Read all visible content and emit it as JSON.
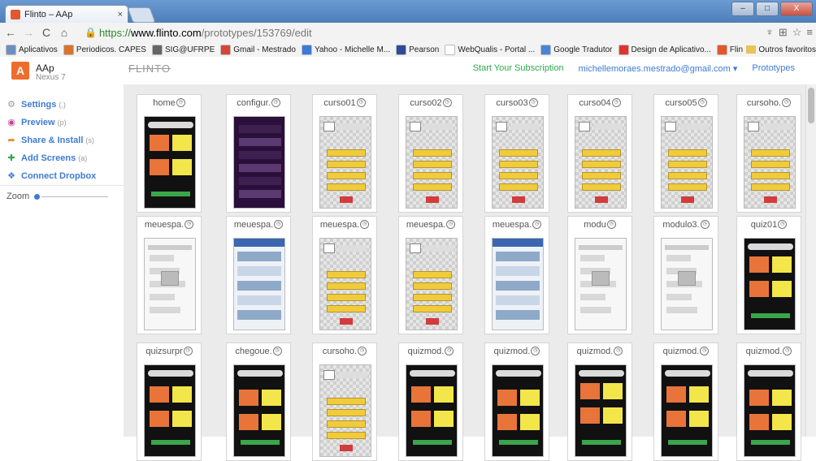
{
  "browser": {
    "tab_title": "Flinto – AAp",
    "tab_close": "×",
    "url_https": "https://",
    "url_host": "www.flinto.com",
    "url_path": "/prototypes/153769/edit",
    "win_min": "–",
    "win_max": "□",
    "win_close": "X"
  },
  "bookmarks": [
    {
      "label": "Aplicativos",
      "color": "#6d8fbf"
    },
    {
      "label": "Periodicos. CAPES",
      "color": "#d9732e"
    },
    {
      "label": "SIG@UFRPE",
      "color": "#666666"
    },
    {
      "label": "Gmail - Mestrado",
      "color": "#d64537"
    },
    {
      "label": "Yahoo - Michelle M...",
      "color": "#3b7bd6"
    },
    {
      "label": "Pearson",
      "color": "#2e4b9a"
    },
    {
      "label": "WebQualis - Portal ...",
      "color": "#ffffff"
    },
    {
      "label": "Google Tradutor",
      "color": "#4a84d8"
    },
    {
      "label": "Design de Aplicativo...",
      "color": "#e0342d"
    },
    {
      "label": "Flinto – Prototypes",
      "color": "#e2572b"
    }
  ],
  "bookmarks_other": "Outros favoritos",
  "app": {
    "icon_letter": "A",
    "name": "AAp",
    "device": "Nexus 7",
    "logo": "FLINTO",
    "subscription": "Start Your Subscription",
    "email": "michellemoraes.mestrado@gmail.com ▾",
    "prototypes": "Prototypes"
  },
  "sidebar": {
    "items": [
      {
        "label": "Settings",
        "key": "(,)",
        "icon": "gear-icon",
        "color": "#999999"
      },
      {
        "label": "Preview",
        "key": "(p)",
        "icon": "eye-icon",
        "color": "#c2459a"
      },
      {
        "label": "Share & Install",
        "key": "(s)",
        "icon": "share-icon",
        "color": "#e38a2c"
      },
      {
        "label": "Add Screens",
        "key": "(a)",
        "icon": "plus-icon",
        "color": "#2fa84f"
      },
      {
        "label": "Connect Dropbox",
        "key": "",
        "icon": "dropbox-icon",
        "color": "#3e7bd4"
      }
    ],
    "zoom_label": "Zoom"
  },
  "screens": [
    {
      "label": "home",
      "style": "black"
    },
    {
      "label": "configur.",
      "style": "purple"
    },
    {
      "label": "curso01",
      "style": "check"
    },
    {
      "label": "curso02",
      "style": "check"
    },
    {
      "label": "curso03",
      "style": "check"
    },
    {
      "label": "curso04",
      "style": "check"
    },
    {
      "label": "curso05",
      "style": "check"
    },
    {
      "label": "cursoho.",
      "style": "check"
    },
    {
      "label": "meuespa.",
      "style": "white"
    },
    {
      "label": "meuespa.",
      "style": "web"
    },
    {
      "label": "meuespa.",
      "style": "check"
    },
    {
      "label": "meuespa.",
      "style": "check"
    },
    {
      "label": "meuespa.",
      "style": "web"
    },
    {
      "label": "modu",
      "style": "white"
    },
    {
      "label": "modulo3.",
      "style": "white"
    },
    {
      "label": "quiz01",
      "style": "black"
    },
    {
      "label": "quizsurpr",
      "style": "black"
    },
    {
      "label": "chegoue.",
      "style": "black"
    },
    {
      "label": "cursoho.",
      "style": "check"
    },
    {
      "label": "quizmod.",
      "style": "black"
    },
    {
      "label": "quizmod.",
      "style": "black"
    },
    {
      "label": "quizmod.",
      "style": "black"
    },
    {
      "label": "quizmod.",
      "style": "black"
    },
    {
      "label": "quizmod.",
      "style": "black"
    }
  ]
}
